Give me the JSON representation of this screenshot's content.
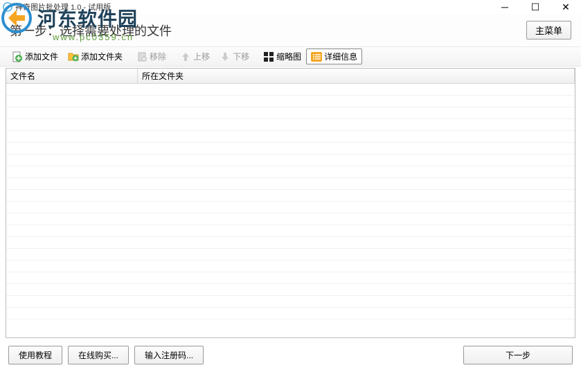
{
  "window": {
    "title": "神奇图片批处理 1.0 - 试用版"
  },
  "watermark": {
    "text": "河东软件园",
    "sub": "www.pc0359.cn"
  },
  "step": {
    "label": "第一步：选择需要处理的文件",
    "main_menu": "主菜单"
  },
  "toolbar": {
    "add_file": "添加文件",
    "add_folder": "添加文件夹",
    "remove": "移除",
    "move_up": "上移",
    "move_down": "下移",
    "thumbnail": "缩略图",
    "detail": "详细信息"
  },
  "table": {
    "col_filename": "文件名",
    "col_folder": "所在文件夹"
  },
  "footer": {
    "tutorial": "使用教程",
    "buy_online": "在线购买...",
    "enter_code": "输入注册码...",
    "next": "下一步"
  }
}
